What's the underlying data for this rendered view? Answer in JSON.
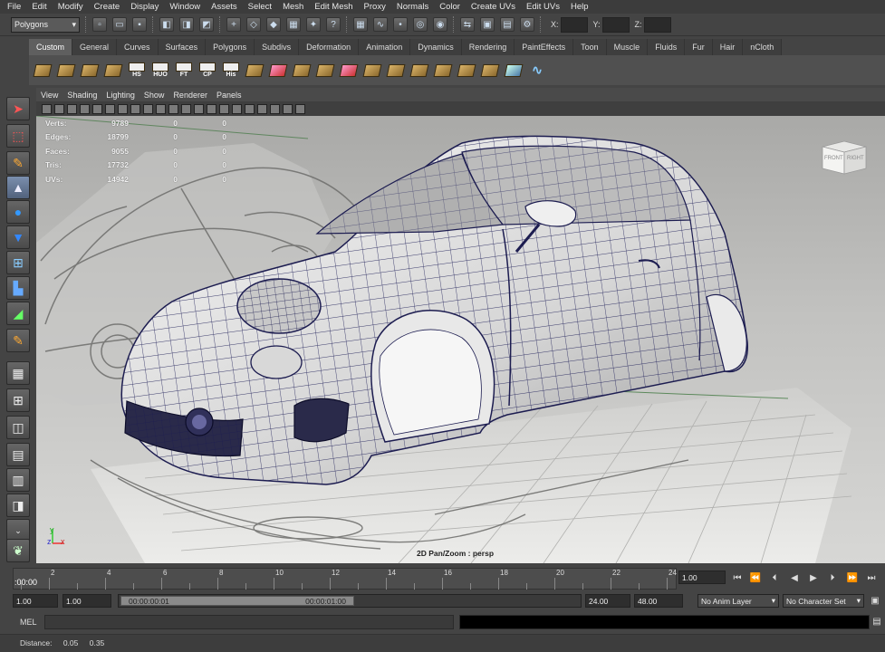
{
  "menu": [
    "File",
    "Edit",
    "Modify",
    "Create",
    "Display",
    "Window",
    "Assets",
    "Select",
    "Mesh",
    "Edit Mesh",
    "Proxy",
    "Normals",
    "Color",
    "Create UVs",
    "Edit UVs",
    "Help"
  ],
  "statusline": {
    "mode": "Polygons",
    "x_label": "X:",
    "y_label": "Y:",
    "z_label": "Z:"
  },
  "shelf": {
    "tabs": [
      "Custom",
      "General",
      "Curves",
      "Surfaces",
      "Polygons",
      "Subdivs",
      "Deformation",
      "Animation",
      "Dynamics",
      "Rendering",
      "PaintEffects",
      "Toon",
      "Muscle",
      "Fluids",
      "Fur",
      "Hair",
      "nCloth"
    ],
    "labelled_icons": [
      "HS",
      "HUO",
      "FT",
      "CP",
      "His"
    ]
  },
  "panel_menu": [
    "View",
    "Shading",
    "Lighting",
    "Show",
    "Renderer",
    "Panels"
  ],
  "hud": {
    "rows": [
      {
        "label": "Verts:",
        "value": "9789",
        "a": "0",
        "b": "0"
      },
      {
        "label": "Edges:",
        "value": "18799",
        "a": "0",
        "b": "0"
      },
      {
        "label": "Faces:",
        "value": "9055",
        "a": "0",
        "b": "0"
      },
      {
        "label": "Tris:",
        "value": "17732",
        "a": "0",
        "b": "0"
      },
      {
        "label": "UVs:",
        "value": "14942",
        "a": "0",
        "b": "0"
      }
    ],
    "camera_label": "2D Pan/Zoom : persp",
    "viewcube": {
      "front": "FRONT",
      "right": "RIGHT"
    },
    "axis": {
      "y": "y",
      "x": "x",
      "z": "z"
    }
  },
  "timeslider": {
    "ticks": [
      "2",
      "4",
      "6",
      "8",
      "10",
      "12",
      "14",
      "16",
      "18",
      "20",
      "22",
      "24"
    ],
    "current_time": ":00:00",
    "current_frame": "1.00"
  },
  "range": {
    "start": "1.00",
    "playback_start": "1.00",
    "range_start_label": "00:00:00:01",
    "range_end_label": "00:00:01:00",
    "playback_end": "24.00",
    "end": "48.00",
    "anim_layer": "No Anim Layer",
    "character_set": "No Character Set"
  },
  "cmdline": {
    "label": "MEL"
  },
  "helpline": {
    "label": "Distance:",
    "v1": "0.05",
    "v2": "0.35"
  }
}
